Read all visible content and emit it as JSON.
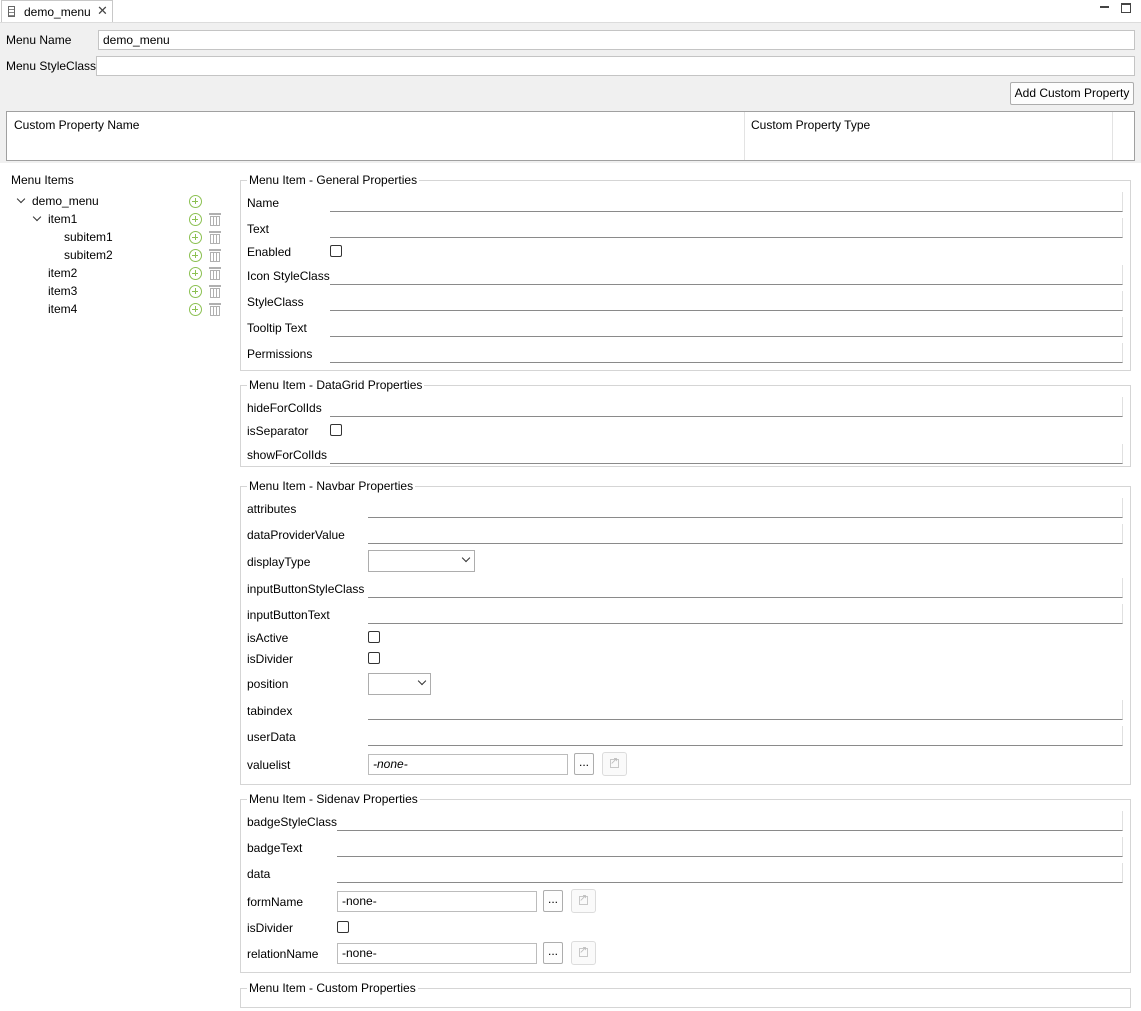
{
  "tab": {
    "title": "demo_menu"
  },
  "menu": {
    "name_label": "Menu Name",
    "name_value": "demo_menu",
    "styleclass_label": "Menu StyleClass",
    "styleclass_value": ""
  },
  "add_custom_property_label": "Add Custom Property",
  "custom_property_table": {
    "columns": [
      "Custom Property Name",
      "Custom Property Type"
    ]
  },
  "tree": {
    "header": "Menu Items",
    "nodes": [
      "demo_menu",
      "item1",
      "subitem1",
      "subitem2",
      "item2",
      "item3",
      "item4"
    ]
  },
  "general": {
    "title": "Menu Item - General Properties",
    "labels": [
      "Name",
      "Text",
      "Enabled",
      "Icon StyleClass",
      "StyleClass",
      "Tooltip Text",
      "Permissions"
    ]
  },
  "datagrid": {
    "title": "Menu Item - DataGrid Properties",
    "labels": [
      "hideForColIds",
      "isSeparator",
      "showForColIds"
    ]
  },
  "navbar": {
    "title": "Menu Item - Navbar Properties",
    "labels": [
      "attributes",
      "dataProviderValue",
      "displayType",
      "inputButtonStyleClass",
      "inputButtonText",
      "isActive",
      "isDivider",
      "position",
      "tabindex",
      "userData",
      "valuelist"
    ],
    "valuelist_value": "-none-",
    "dots_label": "..."
  },
  "sidenav": {
    "title": "Menu Item - Sidenav Properties",
    "labels": [
      "badgeStyleClass",
      "badgeText",
      "data",
      "formName",
      "isDivider",
      "relationName"
    ],
    "formname_value": "-none-",
    "relationname_value": "-none-",
    "dots_label": "..."
  },
  "custom": {
    "title": "Menu Item - Custom Properties"
  },
  "icons": {
    "tab": "menu-file-icon",
    "add": "add-circle-icon",
    "delete": "trash-icon",
    "jump": "open-link-icon",
    "accent_green": "#8cc152"
  }
}
